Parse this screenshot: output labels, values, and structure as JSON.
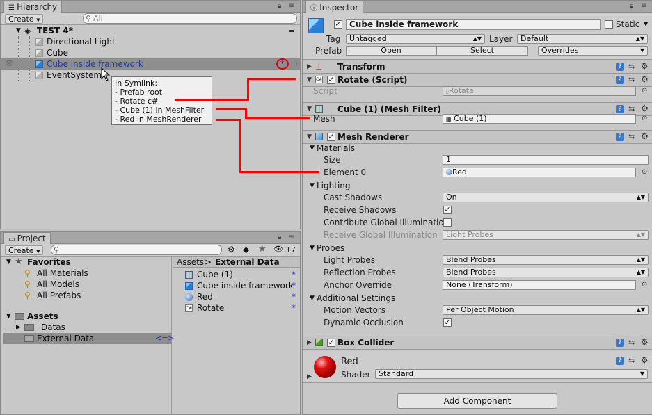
{
  "hierarchy": {
    "tab": "Hierarchy",
    "create_label": "Create",
    "search_placeholder": "All",
    "scene": "TEST 4*",
    "items": [
      "Directional Light",
      "Cube",
      "Cube inside framework",
      "EventSystem"
    ],
    "prefab_marker": "*"
  },
  "tooltip": {
    "title": "In Symlink:",
    "lines": [
      "- Prefab root",
      "- Rotate c#",
      "- Cube (1) in MeshFilter",
      "- Red in MeshRenderer"
    ]
  },
  "project": {
    "tab": "Project",
    "create_label": "Create",
    "hidden_count": "17",
    "favorites_label": "Favorites",
    "favorites": [
      "All Materials",
      "All Models",
      "All Prefabs"
    ],
    "assets_label": "Assets",
    "folders": [
      "_Datas",
      "External Data"
    ],
    "link_marker": "<=>",
    "breadcrumb_root": "Assets",
    "breadcrumb_sep": ">",
    "breadcrumb_current": "External Data",
    "files": [
      "Cube (1)",
      "Cube inside framework",
      "Red",
      "Rotate"
    ],
    "file_marker": "*"
  },
  "inspector": {
    "tab": "Inspector",
    "object_name": "Cube inside framework",
    "static_label": "Static",
    "tag_label": "Tag",
    "tag_value": "Untagged",
    "layer_label": "Layer",
    "layer_value": "Default",
    "prefab_label": "Prefab",
    "open_label": "Open",
    "select_label": "Select",
    "overrides_label": "Overrides",
    "transform": "Transform",
    "rotate": {
      "title": "Rotate (Script)",
      "script_label": "Script",
      "script_value": "Rotate"
    },
    "mesh_filter": {
      "title": "Cube (1) (Mesh Filter)",
      "mesh_label": "Mesh",
      "mesh_value": "Cube (1)"
    },
    "mesh_renderer": {
      "title": "Mesh Renderer",
      "materials": "Materials",
      "size_label": "Size",
      "size_value": "1",
      "element_label": "Element 0",
      "element_value": "Red",
      "lighting": "Lighting",
      "cast_shadows_label": "Cast Shadows",
      "cast_shadows_value": "On",
      "receive_shadows_label": "Receive Shadows",
      "contribute_gi_label": "Contribute Global Illumination",
      "receive_gi_label": "Receive Global Illumination",
      "receive_gi_value": "Light Probes",
      "probes": "Probes",
      "light_probes_label": "Light Probes",
      "light_probes_value": "Blend Probes",
      "reflection_probes_label": "Reflection Probes",
      "reflection_probes_value": "Blend Probes",
      "anchor_label": "Anchor Override",
      "anchor_value": "None (Transform)",
      "additional": "Additional Settings",
      "motion_label": "Motion Vectors",
      "motion_value": "Per Object Motion",
      "dynamic_label": "Dynamic Occlusion"
    },
    "box_collider": "Box Collider",
    "material": {
      "name": "Red",
      "shader_label": "Shader",
      "shader_value": "Standard"
    },
    "add_component": "Add Component"
  },
  "colors": {
    "selection": "#8e8e8e",
    "prefab_blue": "#1a3fb0",
    "annotation_red": "#ff0000",
    "link_blue": "#2a2acc"
  }
}
